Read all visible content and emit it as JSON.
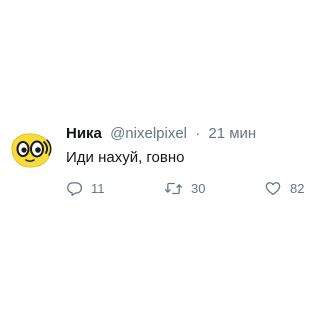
{
  "tweet": {
    "author": {
      "display_name": "Ника",
      "handle": "@nixelpixel",
      "avatar_icon": "yellow-cartoon-face-icon"
    },
    "separator": "·",
    "time_ago": "21 мин",
    "text": "Иди нахуй, говно",
    "actions": {
      "reply": {
        "icon": "reply-icon",
        "count": "11"
      },
      "retweet": {
        "icon": "retweet-icon",
        "count": "30"
      },
      "like": {
        "icon": "heart-icon",
        "count": "82"
      }
    }
  },
  "colors": {
    "text_primary": "#14171a",
    "text_secondary": "#657786",
    "avatar_yellow": "#f7dc3c",
    "background": "#ffffff"
  }
}
